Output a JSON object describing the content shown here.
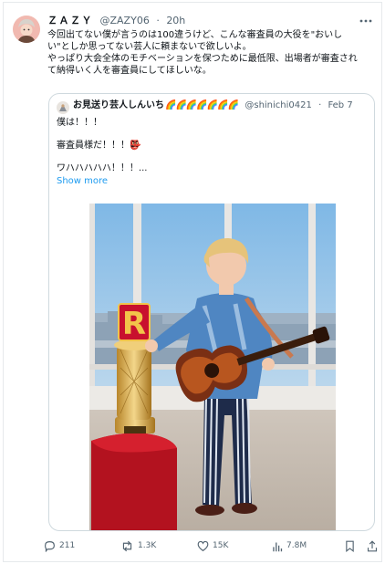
{
  "tweet": {
    "display_name": "ＺＡＺＹ",
    "handle": "@ZAZY06",
    "separator": "·",
    "time": "20h",
    "lines": [
      "今回出てない僕が言うのは100違うけど、こんな審査員の大役を\"おいし",
      "い\"としか思ってない芸人に頼まないで欲しいよ。",
      "やっぱり大会全体のモチベーションを保つために最低限、出場者が審査され",
      "て納得いく人を審査員にしてほしいな。"
    ]
  },
  "quote": {
    "display_name": "お見送り芸人しんいち",
    "rainbows": "🌈🌈🌈🌈🌈🌈🌈",
    "handle": "@shinichi0421",
    "separator": "·",
    "date": "Feb 7",
    "line1": "僕は！！！",
    "line2": "審査員様だ！！！👺",
    "line3": "ワハハハハハ！！！...",
    "show_more": "Show more",
    "photo_trophy_letter": "R"
  },
  "actions": {
    "replies": "211",
    "retweets": "1.3K",
    "likes": "15K",
    "views": "7.8M"
  },
  "colors": {
    "link": "#1d9bf0",
    "muted": "#536471",
    "border": "#cfd9de"
  }
}
